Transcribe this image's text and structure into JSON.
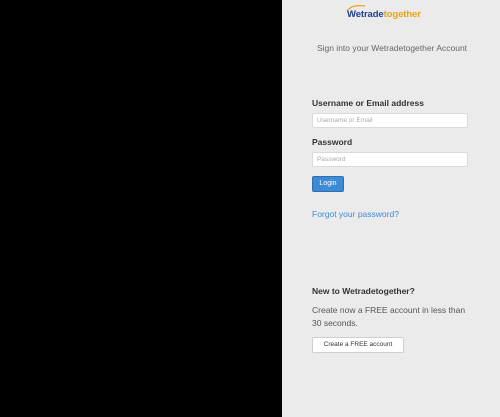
{
  "logo": {
    "part1": "Wetrade",
    "part2": "together"
  },
  "login": {
    "subtitle": "Sign into your Wetradetogether Account",
    "username_label": "Username or Email address",
    "username_placeholder": "Username or Email",
    "password_label": "Password",
    "password_placeholder": "Password",
    "login_button": "Login",
    "forgot_link": "Forgot your password?"
  },
  "signup": {
    "heading": "New to Wetradetogether?",
    "text": "Create now a FREE account in less than 30 seconds.",
    "button": "Create a FREE account"
  },
  "colors": {
    "brand_blue": "#1f3f8f",
    "brand_orange": "#e8a317",
    "accent": "#3d8bd4"
  }
}
